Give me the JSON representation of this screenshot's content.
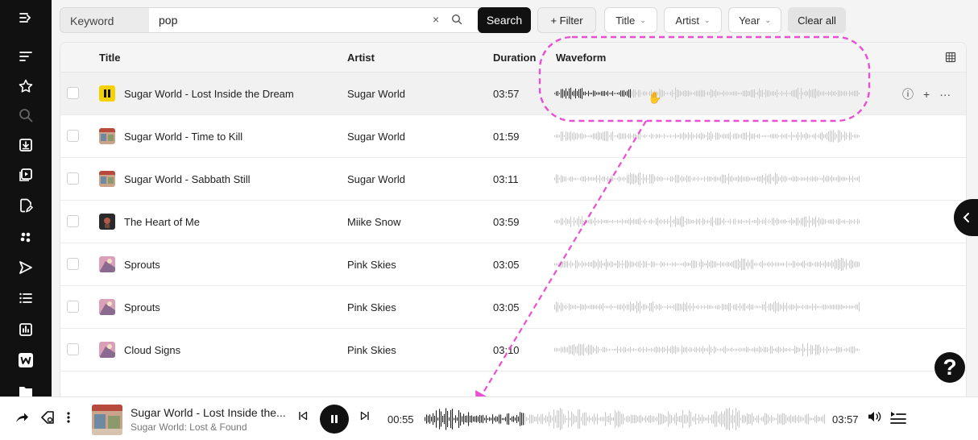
{
  "sidebar": {
    "icons": [
      "collapse-menu-icon",
      "sort-icon",
      "star-icon",
      "search-icon",
      "download-icon",
      "video-icon",
      "document-edit-icon",
      "cluster-icon",
      "send-icon",
      "list-icon",
      "chart-icon",
      "w-logo-icon",
      "folder-icon"
    ]
  },
  "search": {
    "label": "Keyword",
    "value": "pop",
    "clear_glyph": "×",
    "search_button": "Search",
    "filter_button": "+ Filter",
    "facets": [
      "Title",
      "Artist",
      "Year"
    ],
    "clear_all": "Clear all"
  },
  "table": {
    "headers": {
      "title": "Title",
      "artist": "Artist",
      "duration": "Duration",
      "waveform": "Waveform"
    },
    "rows": [
      {
        "title": "Sugar World - Lost Inside the Dream",
        "artist": "Sugar World",
        "duration": "03:57",
        "thumb": "yellow-pause"
      },
      {
        "title": "Sugar World - Time to Kill",
        "artist": "Sugar World",
        "duration": "01:59",
        "thumb": "album-sugar"
      },
      {
        "title": "Sugar World - Sabbath Still",
        "artist": "Sugar World",
        "duration": "03:11",
        "thumb": "album-sugar"
      },
      {
        "title": "The Heart of Me",
        "artist": "Miike Snow",
        "duration": "03:59",
        "thumb": "album-dark"
      },
      {
        "title": "Sprouts",
        "artist": "Pink Skies",
        "duration": "03:05",
        "thumb": "album-pink"
      },
      {
        "title": "Sprouts",
        "artist": "Pink Skies",
        "duration": "03:05",
        "thumb": "album-pink"
      },
      {
        "title": "Cloud Signs",
        "artist": "Pink Skies",
        "duration": "03:10",
        "thumb": "album-pink"
      }
    ],
    "selected_row": 0,
    "row_action_glyphs": {
      "info": "ⓘ",
      "add": "+",
      "more": "···"
    }
  },
  "help": {
    "glyph": "?"
  },
  "player": {
    "title": "Sugar World - Lost Inside the...",
    "album": "Sugar World: Lost & Found",
    "current_time": "00:55",
    "total_time": "03:57",
    "progress": 0.23
  },
  "colors": {
    "annotation": "#e84fd2",
    "wave_played": "#222222",
    "wave_unplayed": "#c8c8c8",
    "accent": "#111111"
  }
}
